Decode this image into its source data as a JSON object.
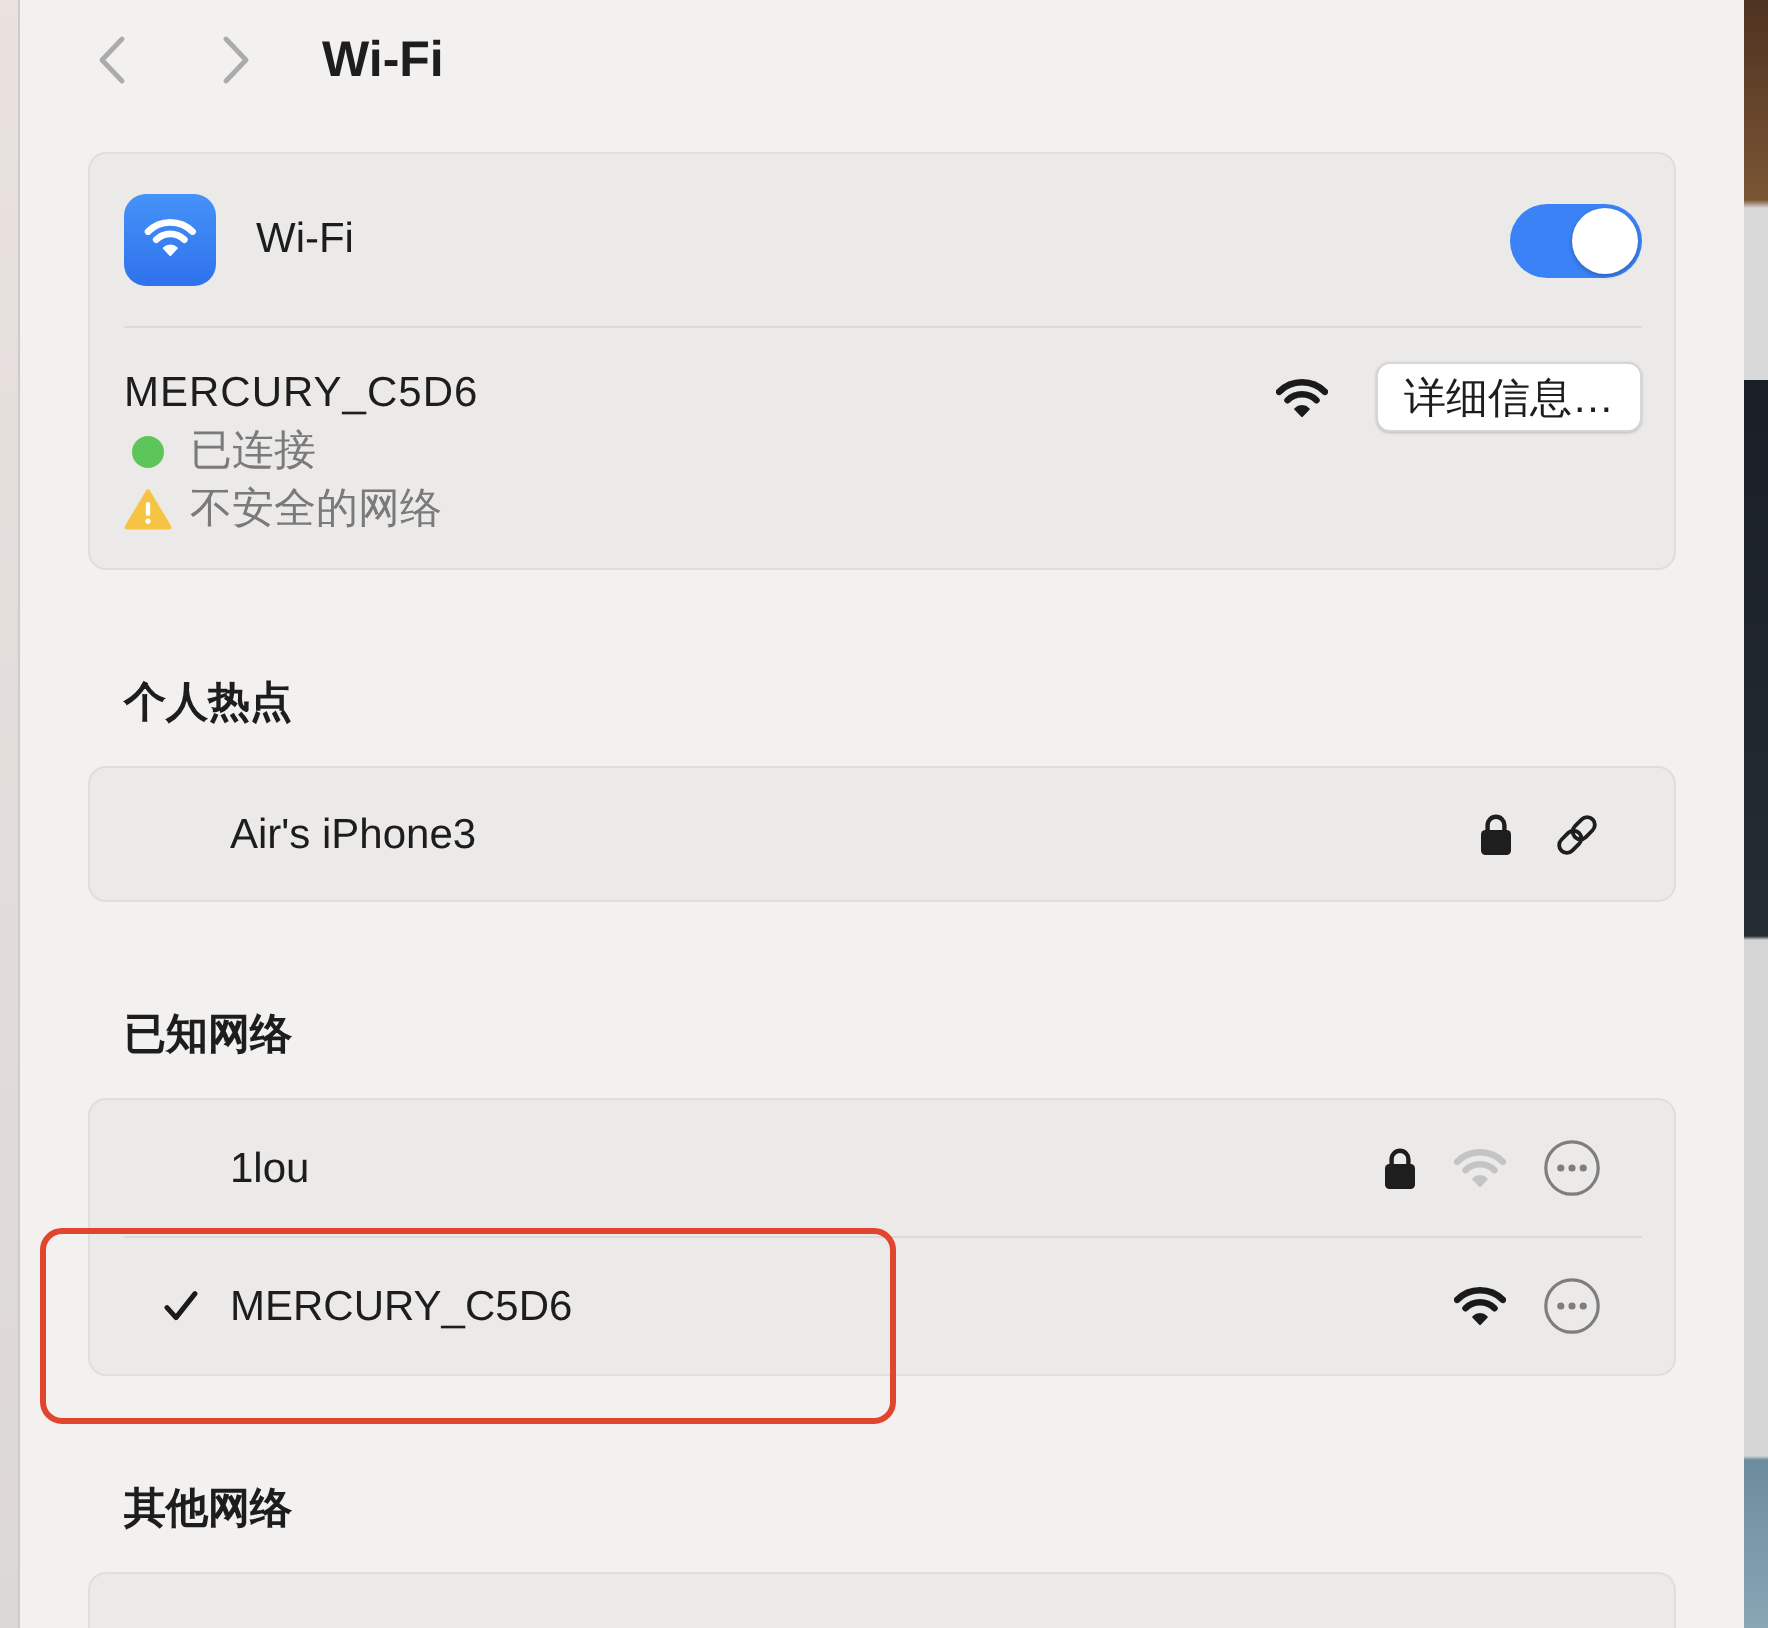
{
  "window": {
    "title": "Wi-Fi"
  },
  "wifi": {
    "label": "Wi-Fi",
    "on": true
  },
  "current_network": {
    "name": "MERCURY_C5D6",
    "details_button": "详细信息…",
    "status": [
      {
        "kind": "connected",
        "text": "已连接"
      },
      {
        "kind": "warning",
        "text": "不安全的网络"
      }
    ]
  },
  "personal_hotspot": {
    "title": "个人热点",
    "items": [
      {
        "name": "Air's iPhone3",
        "secured": true
      }
    ]
  },
  "known_networks": {
    "title": "已知网络",
    "items": [
      {
        "name": "1lou",
        "connected": false,
        "secured": true,
        "in_range": false,
        "highlighted": false
      },
      {
        "name": "MERCURY_C5D6",
        "connected": true,
        "secured": false,
        "in_range": true,
        "highlighted": true
      }
    ]
  },
  "other_networks": {
    "title": "其他网络"
  }
}
